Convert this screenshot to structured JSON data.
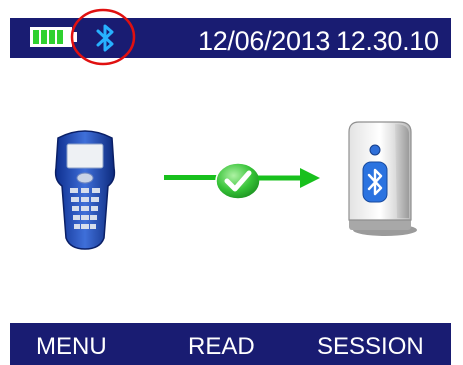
{
  "status_bar": {
    "date": "12/06/2013",
    "time": "12.30.10",
    "battery_level": 0.85,
    "bluetooth_icon": "bluetooth-icon",
    "battery_icon": "battery-icon",
    "colors": {
      "bar": "#191c72",
      "battery": "#2fd12f",
      "bluetooth": "#27b1ff",
      "highlight": "#e01010"
    }
  },
  "main": {
    "source_icon": "handheld-scanner-icon",
    "status_icon": "check-icon",
    "target_icon": "bluetooth-base-station-icon",
    "arrow_color": "#18c01d"
  },
  "softkeys": {
    "menu": "MENU",
    "read": "READ",
    "session": "SESSION"
  }
}
